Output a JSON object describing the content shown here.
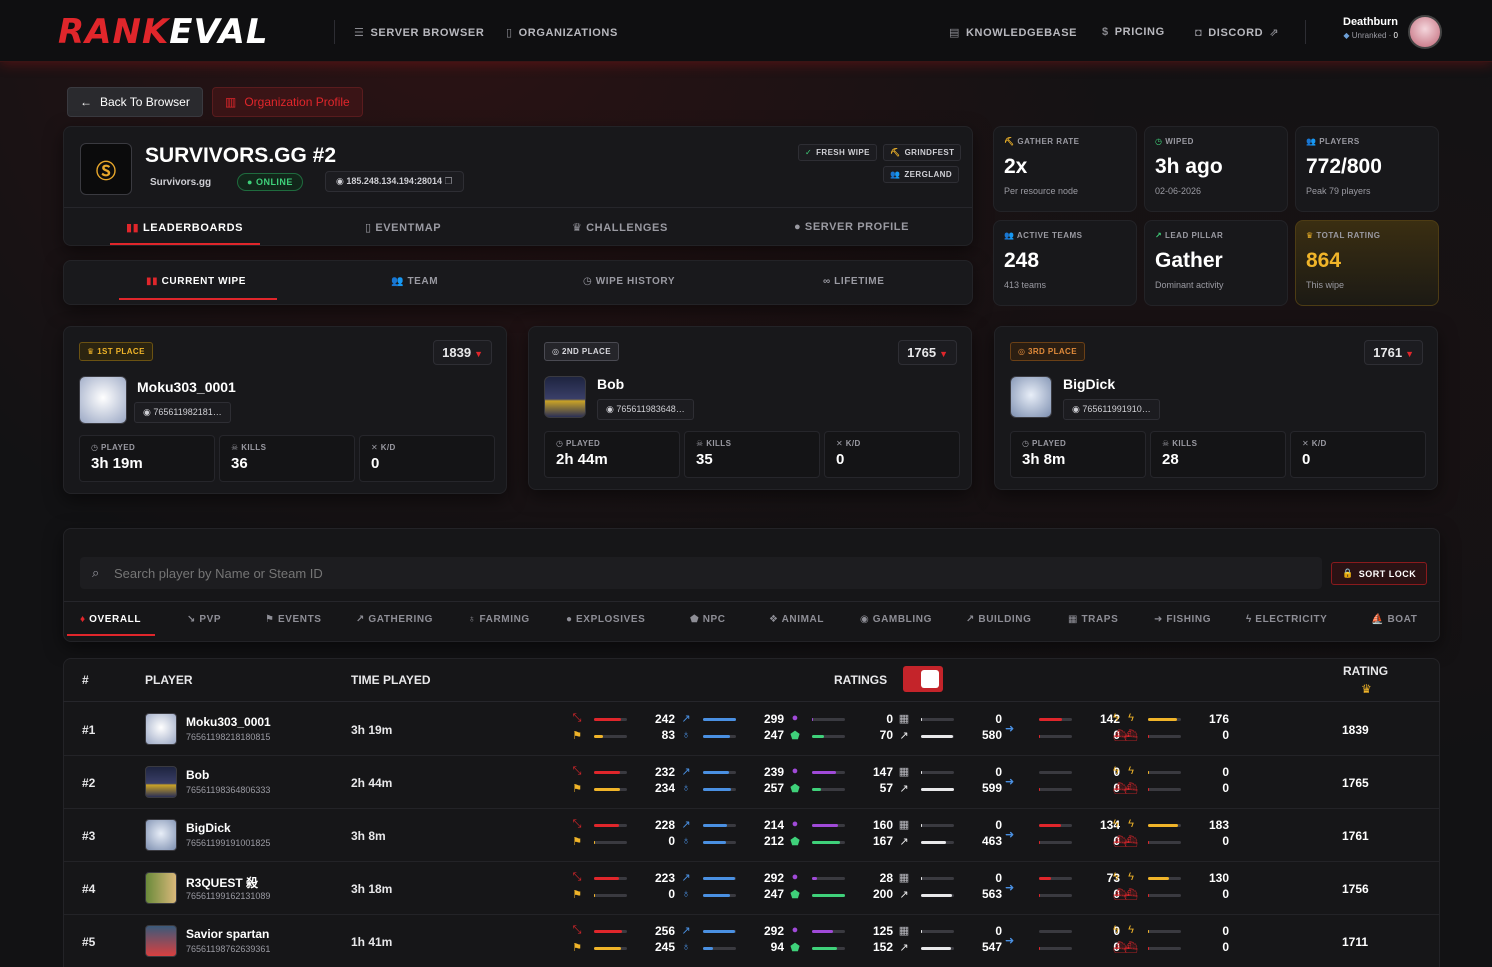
{
  "brand": {
    "logo_red": "RANK",
    "logo_white": "EVAL"
  },
  "nav": {
    "server_browser": "SERVER BROWSER",
    "organizations": "ORGANIZATIONS",
    "knowledgebase": "KNOWLEDGEBASE",
    "pricing": "PRICING",
    "discord": "DISCORD"
  },
  "user": {
    "name": "Deathburn",
    "rank": "Unranked",
    "rank_value": "0"
  },
  "actions": {
    "back": "Back To Browser",
    "org_profile": "Organization Profile"
  },
  "server": {
    "name": "SURVIVORS.GG #2",
    "org": "Survivors.gg",
    "status": "ONLINE",
    "ip": "185.248.134.194:28014",
    "tags": [
      "FRESH WIPE",
      "GRINDFEST",
      "ZERGLAND"
    ]
  },
  "server_tabs": [
    "LEADERBOARDS",
    "EVENTMAP",
    "CHALLENGES",
    "SERVER PROFILE"
  ],
  "wipe_tabs": [
    "CURRENT WIPE",
    "TEAM",
    "WIPE HISTORY",
    "LIFETIME"
  ],
  "stats": [
    {
      "label": "GATHER RATE",
      "value": "2x",
      "sub": "Per resource node"
    },
    {
      "label": "WIPED",
      "value": "3h ago",
      "sub": "02-06-2026"
    },
    {
      "label": "PLAYERS",
      "value": "772/800",
      "sub": "Peak 79 players"
    },
    {
      "label": "ACTIVE TEAMS",
      "value": "248",
      "sub": "413 teams"
    },
    {
      "label": "LEAD PILLAR",
      "value": "Gather",
      "sub": "Dominant activity"
    },
    {
      "label": "TOTAL RATING",
      "value": "864",
      "sub": "This wipe"
    }
  ],
  "podium": [
    {
      "place": "1ST PLACE",
      "score": "1839",
      "name": "Moku303_0001",
      "steam": "765611982181…",
      "played_label": "PLAYED",
      "played": "3h 19m",
      "kills_label": "KILLS",
      "kills": "36",
      "kd_label": "K/D",
      "kd": "0"
    },
    {
      "place": "2ND PLACE",
      "score": "1765",
      "name": "Bob",
      "steam": "765611983648…",
      "played_label": "PLAYED",
      "played": "2h 44m",
      "kills_label": "KILLS",
      "kills": "35",
      "kd_label": "K/D",
      "kd": "0"
    },
    {
      "place": "3RD PLACE",
      "score": "1761",
      "name": "BigDick",
      "steam": "765611991910…",
      "played_label": "PLAYED",
      "played": "3h 8m",
      "kills_label": "KILLS",
      "kills": "28",
      "kd_label": "K/D",
      "kd": "0"
    }
  ],
  "search": {
    "placeholder": "Search player by Name or Steam ID",
    "sort_lock": "SORT LOCK"
  },
  "categories": [
    "OVERALL",
    "PVP",
    "EVENTS",
    "GATHERING",
    "FARMING",
    "EXPLOSIVES",
    "NPC",
    "ANIMAL",
    "GAMBLING",
    "BUILDING",
    "TRAPS",
    "FISHING",
    "ELECTRICITY",
    "BOAT"
  ],
  "table": {
    "col_rank": "#",
    "col_player": "PLAYER",
    "col_time": "TIME PLAYED",
    "col_ratings": "RATINGS",
    "col_rating": "RATING"
  },
  "rows": [
    {
      "rank": "#1",
      "name": "Moku303_0001",
      "steam": "76561198218180815",
      "time": "3h 19m",
      "vals": [
        [
          "242",
          "83"
        ],
        [
          "299",
          "247"
        ],
        [
          "0",
          "70"
        ],
        [
          "0",
          "580"
        ],
        [
          "142",
          "0"
        ],
        [
          "176",
          "0"
        ]
      ],
      "rating": "1839"
    },
    {
      "rank": "#2",
      "name": "Bob",
      "steam": "76561198364806333",
      "time": "2h 44m",
      "vals": [
        [
          "232",
          "234"
        ],
        [
          "239",
          "257"
        ],
        [
          "147",
          "57"
        ],
        [
          "0",
          "599"
        ],
        [
          "0",
          "0"
        ],
        [
          "0",
          "0"
        ]
      ],
      "rating": "1765"
    },
    {
      "rank": "#3",
      "name": "BigDick",
      "steam": "76561199191001825",
      "time": "3h 8m",
      "vals": [
        [
          "228",
          "0"
        ],
        [
          "214",
          "212"
        ],
        [
          "160",
          "167"
        ],
        [
          "0",
          "463"
        ],
        [
          "134",
          "0"
        ],
        [
          "183",
          "0"
        ]
      ],
      "rating": "1761"
    },
    {
      "rank": "#4",
      "name": "R3QUEST 殺",
      "steam": "76561199162131089",
      "time": "3h 18m",
      "vals": [
        [
          "223",
          "0"
        ],
        [
          "292",
          "247"
        ],
        [
          "28",
          "200"
        ],
        [
          "0",
          "563"
        ],
        [
          "73",
          "0"
        ],
        [
          "130",
          "0"
        ]
      ],
      "rating": "1756"
    },
    {
      "rank": "#5",
      "name": "Savior spartan",
      "steam": "76561198762639361",
      "time": "1h 41m",
      "vals": [
        [
          "256",
          "245"
        ],
        [
          "292",
          "94"
        ],
        [
          "125",
          "152"
        ],
        [
          "0",
          "547"
        ],
        [
          "0",
          "0"
        ],
        [
          "0",
          "0"
        ]
      ],
      "rating": "1711"
    }
  ],
  "colors": {
    "accent": "#e0262b",
    "gold": "#f0b429",
    "bg": "#121214"
  }
}
